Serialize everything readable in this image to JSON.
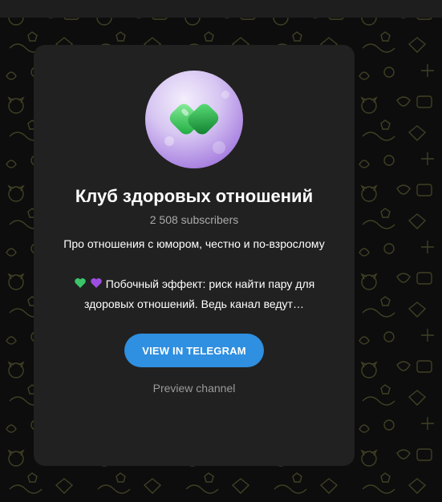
{
  "channel": {
    "title": "Клуб здоровых отношений",
    "subscribers": "2 508 subscribers",
    "description_line1": "Про отношения с юмором, честно и по-взрослому",
    "description_line2": "Побочный эффект: риск найти пару для здоровых отношений. Ведь канал ведут…",
    "description_emojis": [
      "green-heart",
      "purple-heart"
    ]
  },
  "actions": {
    "view_button": "VIEW IN TELEGRAM",
    "preview_link": "Preview channel"
  },
  "colors": {
    "background": "#0d0d0d",
    "card": "#212121",
    "accent_button": "#2f8fe0",
    "muted_text": "#aaaaaa",
    "pattern_doodles": "#4a4a2c"
  }
}
